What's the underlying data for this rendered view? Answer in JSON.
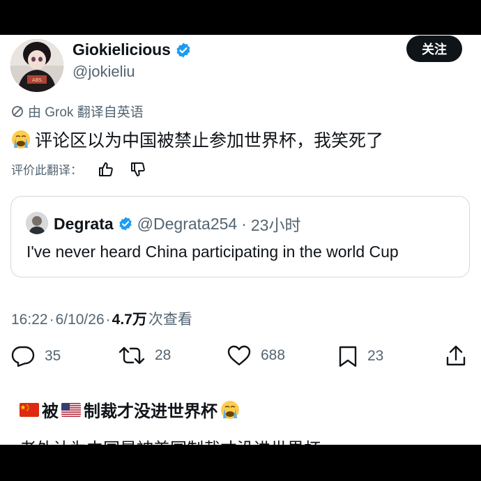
{
  "author": {
    "display_name": "Giokielicious",
    "handle": "@jokieliu",
    "avatar_icon": "avatar-image",
    "verified_icon": "verified-badge-icon"
  },
  "follow_button": {
    "label": "关注"
  },
  "translation": {
    "label": "由 Grok 翻译自英语",
    "icon": "translate-slash-icon"
  },
  "tweet": {
    "emoji": "loudly-crying-face-emoji",
    "text": "评论区以为中国被禁止参加世界杯，我笑死了"
  },
  "rate_translation": {
    "label": "评价此翻译：",
    "thumbs_up_icon": "thumbs-up-icon",
    "thumbs_down_icon": "thumbs-down-icon"
  },
  "quote": {
    "name": "Degrata",
    "handle": "@Degrata254",
    "separator": "·",
    "time": "23小时",
    "text": "I've never heard China participating in the world Cup"
  },
  "meta": {
    "time": "16:22",
    "sep1": "·",
    "date": "6/10/26",
    "sep2": "·",
    "views_count": "4.7万",
    "views_label": " 次查看"
  },
  "actions": {
    "reply": {
      "icon": "reply-icon",
      "count": "35"
    },
    "repost": {
      "icon": "repost-icon",
      "count": "28"
    },
    "like": {
      "icon": "heart-icon",
      "count": "688"
    },
    "bookmark": {
      "icon": "bookmark-icon",
      "count": "23"
    },
    "share": {
      "icon": "share-icon"
    }
  },
  "caption": {
    "part1": "被",
    "part2": "制裁才没进世界杯",
    "flag1": "china-flag",
    "flag2": "us-flag",
    "emoji": "loudly-crying-face-emoji"
  },
  "partial_text": "老外认为中国是被美国制裁才没进世界杯",
  "colors": {
    "text_primary": "#0f1419",
    "text_secondary": "#536471",
    "verified_blue": "#1d9bf0",
    "border": "#cfd9de",
    "background": "#ffffff"
  }
}
